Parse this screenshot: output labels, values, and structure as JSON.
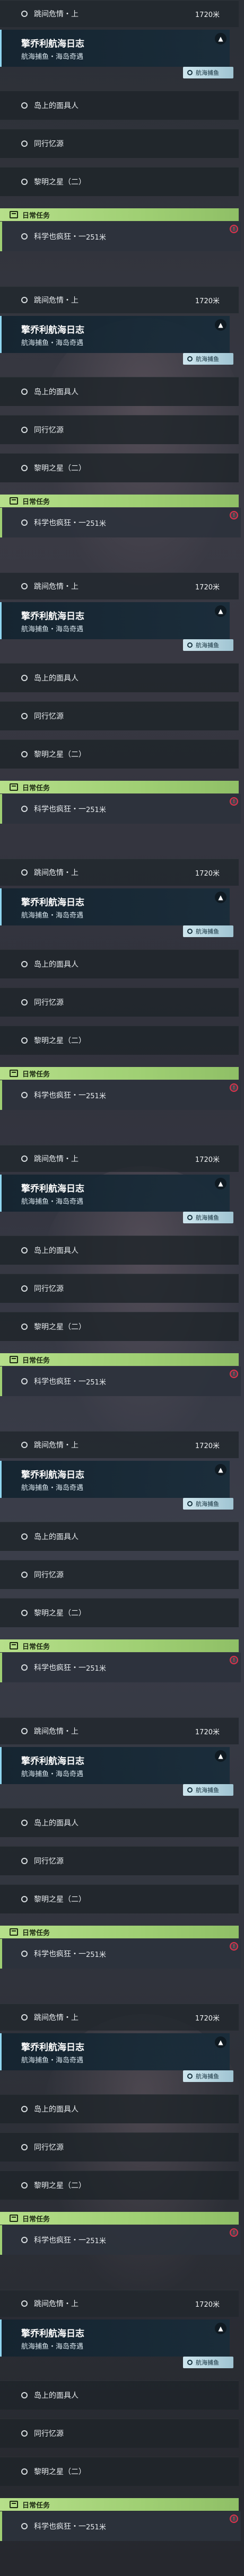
{
  "quest": {
    "top_item": "跳间危情・上",
    "top_distance": "1720米",
    "title": "擎乔利航海日志",
    "subtitle": "航海捕鱼・海岛奇遇",
    "area_tag": "航海捕鱼",
    "collapse_symbol": "▲",
    "items": [
      "岛上的面具人",
      "同行忆源",
      "黎明之星（二）"
    ]
  },
  "daily": {
    "label": "日常任务",
    "item": "科学也疯狂・一",
    "distance": "251米",
    "alert_symbol": "!"
  },
  "panel_count": 9
}
